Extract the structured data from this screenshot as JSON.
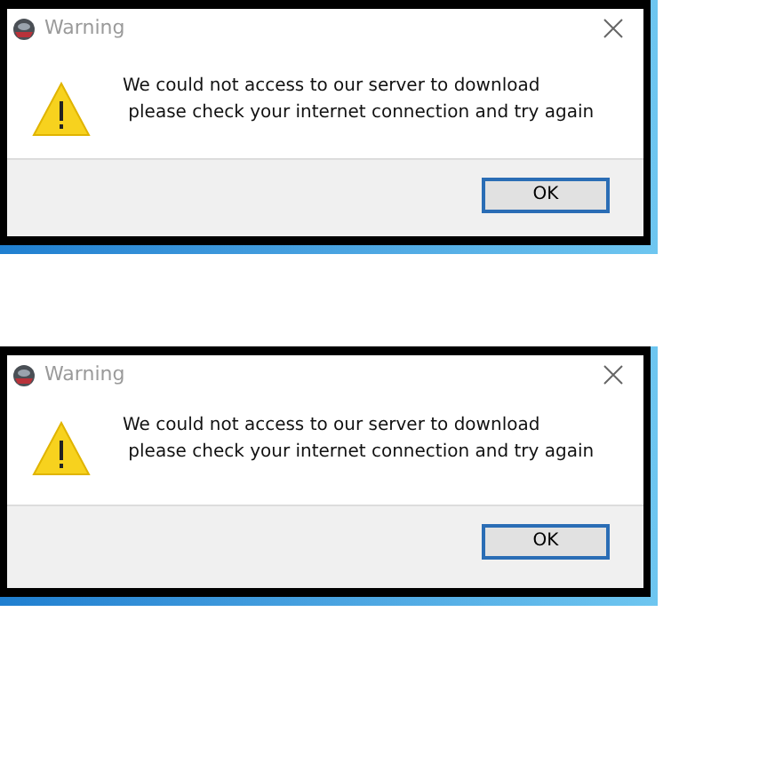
{
  "dialogs": [
    {
      "title": "Warning",
      "message_lines": [
        "We could not access to our server to download",
        " please check your internet connection and try again"
      ],
      "buttons": [
        {
          "label": "OK",
          "selected": true
        }
      ]
    },
    {
      "title": "Warning",
      "message_lines": [
        "We could not access to our server to download",
        " please check your internet connection and try again"
      ],
      "buttons": [
        {
          "label": "OK",
          "selected": true
        }
      ]
    }
  ]
}
